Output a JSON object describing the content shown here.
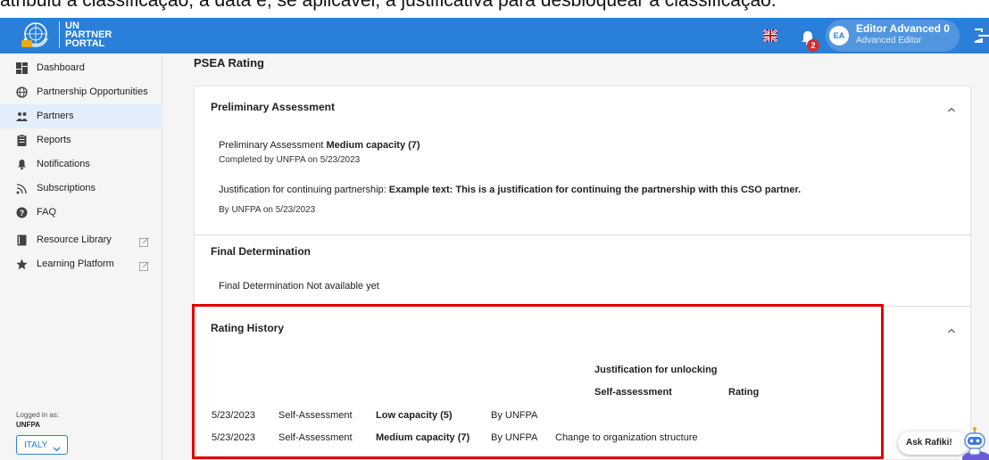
{
  "caption_fragment": "atribuiu a classificação, a data e, se aplicável, a justificativa para desbloquear a classificação.",
  "header": {
    "logo_lines": [
      "UN",
      "PARTNER",
      "PORTAL"
    ],
    "notification_count": "2",
    "user_initials": "EA",
    "user_name": "Editor Advanced 0",
    "user_role": "Advanced Editor",
    "brand_color": "#2a7fd8"
  },
  "sidebar": {
    "items": [
      {
        "label": "Dashboard",
        "icon": "dashboard-icon"
      },
      {
        "label": "Partnership Opportunities",
        "icon": "globe-icon"
      },
      {
        "label": "Partners",
        "icon": "people-icon",
        "active": true
      },
      {
        "label": "Reports",
        "icon": "report-icon"
      },
      {
        "label": "Notifications",
        "icon": "bell-icon"
      },
      {
        "label": "Subscriptions",
        "icon": "rss-icon"
      },
      {
        "label": "FAQ",
        "icon": "help-icon"
      },
      {
        "label": "Resource Library",
        "icon": "book-icon",
        "external": true
      },
      {
        "label": "Learning Platform",
        "icon": "star-icon",
        "external": true
      }
    ],
    "logged_in_label": "Logged in as:",
    "logged_in_org": "UNFPA",
    "country": "ITALY"
  },
  "main": {
    "heading": "PSEA Rating",
    "preliminary": {
      "title": "Preliminary Assessment",
      "line_label": "Preliminary Assessment",
      "line_value": "Medium capacity (7)",
      "completed_by": "Completed by UNFPA on 5/23/2023",
      "justification_label": "Justification for continuing partnership:",
      "justification_text": "Example text: This is a justification for continuing the partnership with this CSO partner.",
      "justification_by": "By UNFPA on 5/23/2023"
    },
    "final": {
      "title": "Final Determination",
      "label": "Final Determination",
      "value": "Not available yet"
    },
    "history": {
      "title": "Rating History",
      "header_justification": "Justification for unlocking",
      "header_self_assessment": "Self-assessment",
      "header_rating": "Rating",
      "rows": [
        {
          "date": "5/23/2023",
          "type": "Self-Assessment",
          "rating": "Low capacity (5)",
          "by": "By UNFPA",
          "justification": ""
        },
        {
          "date": "5/23/2023",
          "type": "Self-Assessment",
          "rating": "Medium capacity (7)",
          "by": "By UNFPA",
          "justification": "Change to organization structure"
        }
      ]
    }
  },
  "assistant": {
    "label": "Ask Rafiki!"
  },
  "colors": {
    "highlight_border": "#e00000",
    "notification_badge": "#d32f2f"
  }
}
